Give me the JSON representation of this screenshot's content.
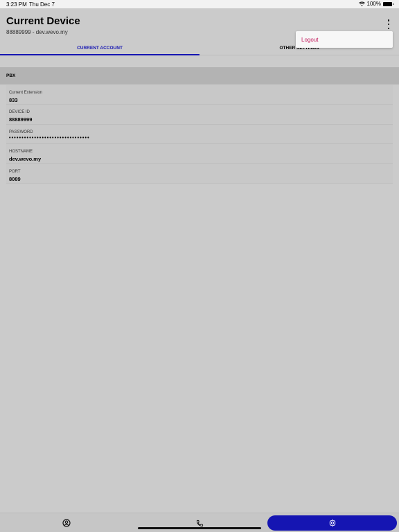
{
  "status_bar": {
    "time": "3:23 PM",
    "date": "Thu Dec 7",
    "battery_text": "100%",
    "battery_level": 1.0
  },
  "header": {
    "title": "Current Device",
    "subtitle": "88889999 - dev.wevo.my",
    "menu_icon": "more-vertical-icon"
  },
  "tabs": [
    {
      "label": "CURRENT ACCOUNT",
      "active": true
    },
    {
      "label": "OTHER SETTINGS",
      "active": false
    }
  ],
  "dropdown": {
    "items": [
      {
        "label": "Logout"
      }
    ]
  },
  "section": {
    "title": "PBX"
  },
  "fields": [
    {
      "label": "Current Extension",
      "value": "833"
    },
    {
      "label": "DEVICE ID",
      "value": "88889999"
    },
    {
      "label": "PASSWORD",
      "value": "••••••••••••••••••••••••••••••••"
    },
    {
      "label": "HOSTNAME",
      "value": "dev.wevo.my"
    },
    {
      "label": "PORT",
      "value": "8089"
    }
  ],
  "bottom_nav": [
    {
      "icon": "account-circle-icon",
      "active": false
    },
    {
      "icon": "phone-icon",
      "active": false
    },
    {
      "icon": "settings-gear-icon",
      "active": true
    }
  ],
  "colors": {
    "accent": "#1515b2",
    "logout": "#c2185b",
    "background": "#cbcbcb"
  }
}
